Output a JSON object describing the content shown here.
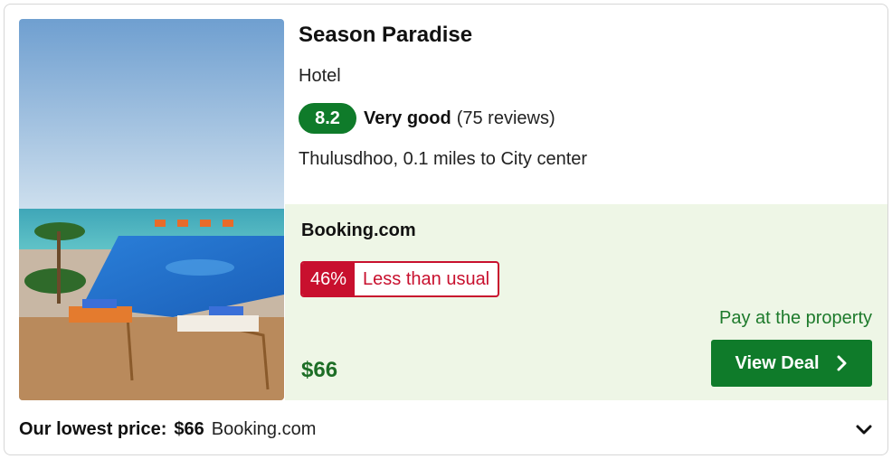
{
  "hotel": {
    "name": "Season Paradise",
    "property_type": "Hotel",
    "rating": {
      "score": "8.2",
      "word": "Very good",
      "reviews": "(75 reviews)"
    },
    "location": "Thulusdhoo, 0.1 miles to City center",
    "photo_icon": "hotel-pool-photo"
  },
  "deal": {
    "provider": "Booking.com",
    "discount_pct": "46%",
    "discount_text": "Less than usual",
    "pay_note": "Pay at the property",
    "price": "$66",
    "button_label": "View Deal",
    "button_icon": "chevron-right-icon"
  },
  "footer": {
    "label": "Our lowest price:",
    "price": "$66",
    "provider": "Booking.com",
    "toggle_icon": "chevron-down-icon"
  },
  "colors": {
    "score_bg": "#0f7b2a",
    "deal_bg": "#eef6e6",
    "discount_red": "#c8102e",
    "price_green": "#1d6e26",
    "button_green": "#0f7b2a"
  }
}
